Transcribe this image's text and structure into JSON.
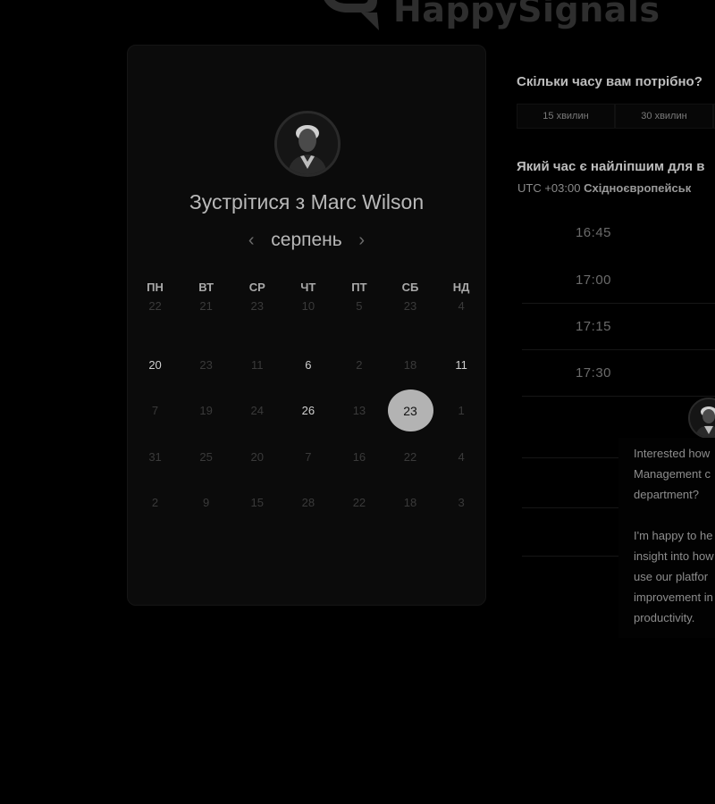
{
  "brand": {
    "name": "HappySignals"
  },
  "meeting": {
    "title": "Зустрітися з Marc Wilson"
  },
  "calendar": {
    "month": "серпень",
    "prev_icon": "chevron-left-icon",
    "next_icon": "chevron-right-icon",
    "weekdays": [
      "ПН",
      "ВТ",
      "СР",
      "ЧТ",
      "ПТ",
      "СБ",
      "НД"
    ],
    "days": [
      [
        "22",
        "21",
        "23",
        "10",
        "5",
        "23",
        "4"
      ],
      [
        "20",
        "23",
        "11",
        "6",
        "2",
        "18",
        "11"
      ],
      [
        "7",
        "19",
        "24",
        "26",
        "13",
        "23",
        "1"
      ],
      [
        "31",
        "25",
        "20",
        "7",
        "16",
        "22",
        "4"
      ],
      [
        "2",
        "9",
        "15",
        "28",
        "22",
        "18",
        "3"
      ]
    ],
    "selected": "23"
  },
  "duration": {
    "question": "Скільки часу вам потрібно?",
    "options": [
      "15 хвилин",
      "30 хвилин",
      ""
    ]
  },
  "time": {
    "question": "Який час є найліпшим для в",
    "tz_offset": "UTC +03:00",
    "tz_name": "Східноєвропейськ",
    "slots": [
      "16:45",
      "17:00",
      "17:15",
      "17:30"
    ]
  },
  "chat": {
    "lines": [
      "Interested how",
      "Management c",
      "department?",
      "",
      "I'm happy to he",
      "insight into how",
      "use our platfor",
      "improvement in",
      "productivity."
    ]
  },
  "colors": {
    "background": "#000000",
    "card": "#0b0b0b",
    "selected_day": "#b3b3b3"
  }
}
